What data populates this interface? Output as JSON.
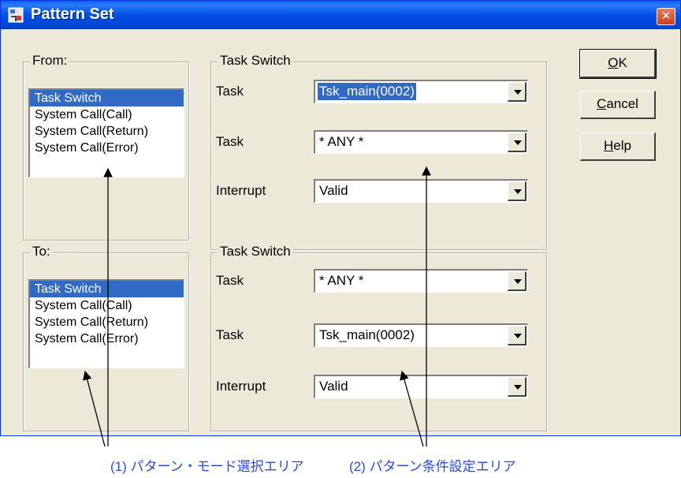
{
  "window": {
    "title": "Pattern Set",
    "close_label": "✕"
  },
  "from_group": {
    "label": "From:",
    "items": [
      "Task Switch",
      "System Call(Call)",
      "System Call(Return)",
      "System Call(Error)"
    ],
    "selected_index": 0
  },
  "to_group": {
    "label": "To:",
    "items": [
      "Task Switch",
      "System Call(Call)",
      "System Call(Return)",
      "System Call(Error)"
    ],
    "selected_index": 0
  },
  "upper_condition": {
    "label": "Task Switch",
    "rows": [
      {
        "label": "Task",
        "value": "Tsk_main(0002)",
        "highlighted": true
      },
      {
        "label": "Task",
        "value": "* ANY *"
      },
      {
        "label": "Interrupt",
        "value": "Valid"
      }
    ]
  },
  "lower_condition": {
    "label": "Task Switch",
    "rows": [
      {
        "label": "Task",
        "value": "* ANY *"
      },
      {
        "label": "Task",
        "value": "Tsk_main(0002)"
      },
      {
        "label": "Interrupt",
        "value": "Valid"
      }
    ]
  },
  "buttons": {
    "ok_mnemonic": "O",
    "ok_rest": "K",
    "cancel_mnemonic": "C",
    "cancel_rest": "ancel",
    "help_mnemonic": "H",
    "help_rest": "elp"
  },
  "annotations": {
    "left": "(1) パターン・モード選択エリア",
    "right": "(2) パターン条件設定エリア"
  },
  "icons": [
    "app-icon",
    "close-icon",
    "dropdown-arrow-icon"
  ],
  "colors": {
    "title_bar": "#0050e6",
    "selection": "#316ac5",
    "annotation_text": "#2a4bd7",
    "dialog_bg": "#ece9d8"
  }
}
